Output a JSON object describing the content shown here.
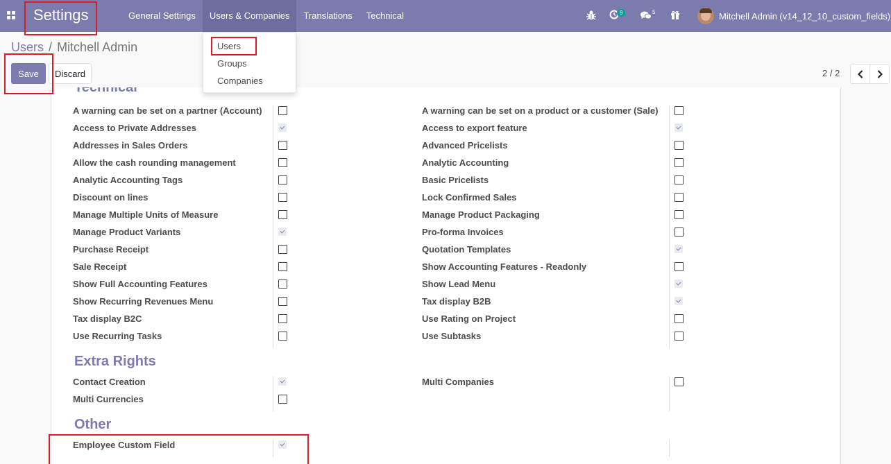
{
  "navbar": {
    "app_name": "Settings",
    "menu": [
      "General Settings",
      "Users & Companies",
      "Translations",
      "Technical"
    ],
    "activity_count": "9",
    "message_count": "5",
    "user_name": "Mitchell Admin (v14_12_10_custom_fields)",
    "icons": [
      "apps-icon",
      "bug-icon",
      "activity-clock-icon",
      "chat-bubbles-icon",
      "gift-icon"
    ]
  },
  "dropdown": {
    "items": [
      "Users",
      "Groups",
      "Companies"
    ]
  },
  "breadcrumb": {
    "parent": "Users",
    "separator": "/",
    "current": "Mitchell Admin"
  },
  "buttons": {
    "save": "Save",
    "discard": "Discard"
  },
  "pager": {
    "value": "2 / 2"
  },
  "sections": {
    "technical": {
      "title": "Technical",
      "left": [
        {
          "label": "A warning can be set on a partner (Account)",
          "checked": false
        },
        {
          "label": "Access to Private Addresses",
          "checked": true
        },
        {
          "label": "Addresses in Sales Orders",
          "checked": false
        },
        {
          "label": "Allow the cash rounding management",
          "checked": false
        },
        {
          "label": "Analytic Accounting Tags",
          "checked": false
        },
        {
          "label": "Discount on lines",
          "checked": false
        },
        {
          "label": "Manage Multiple Units of Measure",
          "checked": false
        },
        {
          "label": "Manage Product Variants",
          "checked": true
        },
        {
          "label": "Purchase Receipt",
          "checked": false
        },
        {
          "label": "Sale Receipt",
          "checked": false
        },
        {
          "label": "Show Full Accounting Features",
          "checked": false
        },
        {
          "label": "Show Recurring Revenues Menu",
          "checked": false
        },
        {
          "label": "Tax display B2C",
          "checked": false
        },
        {
          "label": "Use Recurring Tasks",
          "checked": false
        }
      ],
      "right": [
        {
          "label": "A warning can be set on a product or a customer (Sale)",
          "checked": false
        },
        {
          "label": "Access to export feature",
          "checked": true
        },
        {
          "label": "Advanced Pricelists",
          "checked": false
        },
        {
          "label": "Analytic Accounting",
          "checked": false
        },
        {
          "label": "Basic Pricelists",
          "checked": false
        },
        {
          "label": "Lock Confirmed Sales",
          "checked": false
        },
        {
          "label": "Manage Product Packaging",
          "checked": false
        },
        {
          "label": "Pro-forma Invoices",
          "checked": false
        },
        {
          "label": "Quotation Templates",
          "checked": true
        },
        {
          "label": "Show Accounting Features - Readonly",
          "checked": false
        },
        {
          "label": "Show Lead Menu",
          "checked": true
        },
        {
          "label": "Tax display B2B",
          "checked": true
        },
        {
          "label": "Use Rating on Project",
          "checked": false
        },
        {
          "label": "Use Subtasks",
          "checked": false
        }
      ]
    },
    "extra_rights": {
      "title": "Extra Rights",
      "left": [
        {
          "label": "Contact Creation",
          "checked": true
        },
        {
          "label": "Multi Currencies",
          "checked": false
        }
      ],
      "right": [
        {
          "label": "Multi Companies",
          "checked": false
        }
      ]
    },
    "other": {
      "title": "Other",
      "left": [
        {
          "label": "Employee Custom Field",
          "checked": true
        }
      ],
      "right": []
    }
  },
  "colors": {
    "brand": "#7c7bad",
    "highlight": "#e01b24"
  }
}
